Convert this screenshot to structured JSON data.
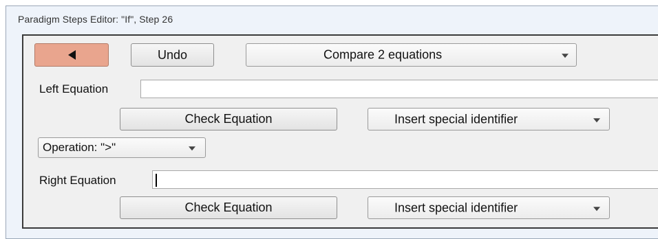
{
  "window": {
    "title": "Paradigm Steps Editor: \"If\", Step 26"
  },
  "toolbar": {
    "back_icon": "back-arrow-icon",
    "back_color": "#e9a58e",
    "undo_label": "Undo",
    "step_type": {
      "selected": "Compare 2 equations"
    }
  },
  "left_equation": {
    "label": "Left Equation",
    "value": "",
    "check_label": "Check Equation",
    "insert_label": "Insert special identifier"
  },
  "operation": {
    "selected": "Operation: \">\""
  },
  "right_equation": {
    "label": "Right Equation",
    "value": "",
    "check_label": "Check Equation",
    "insert_label": "Insert special identifier"
  }
}
